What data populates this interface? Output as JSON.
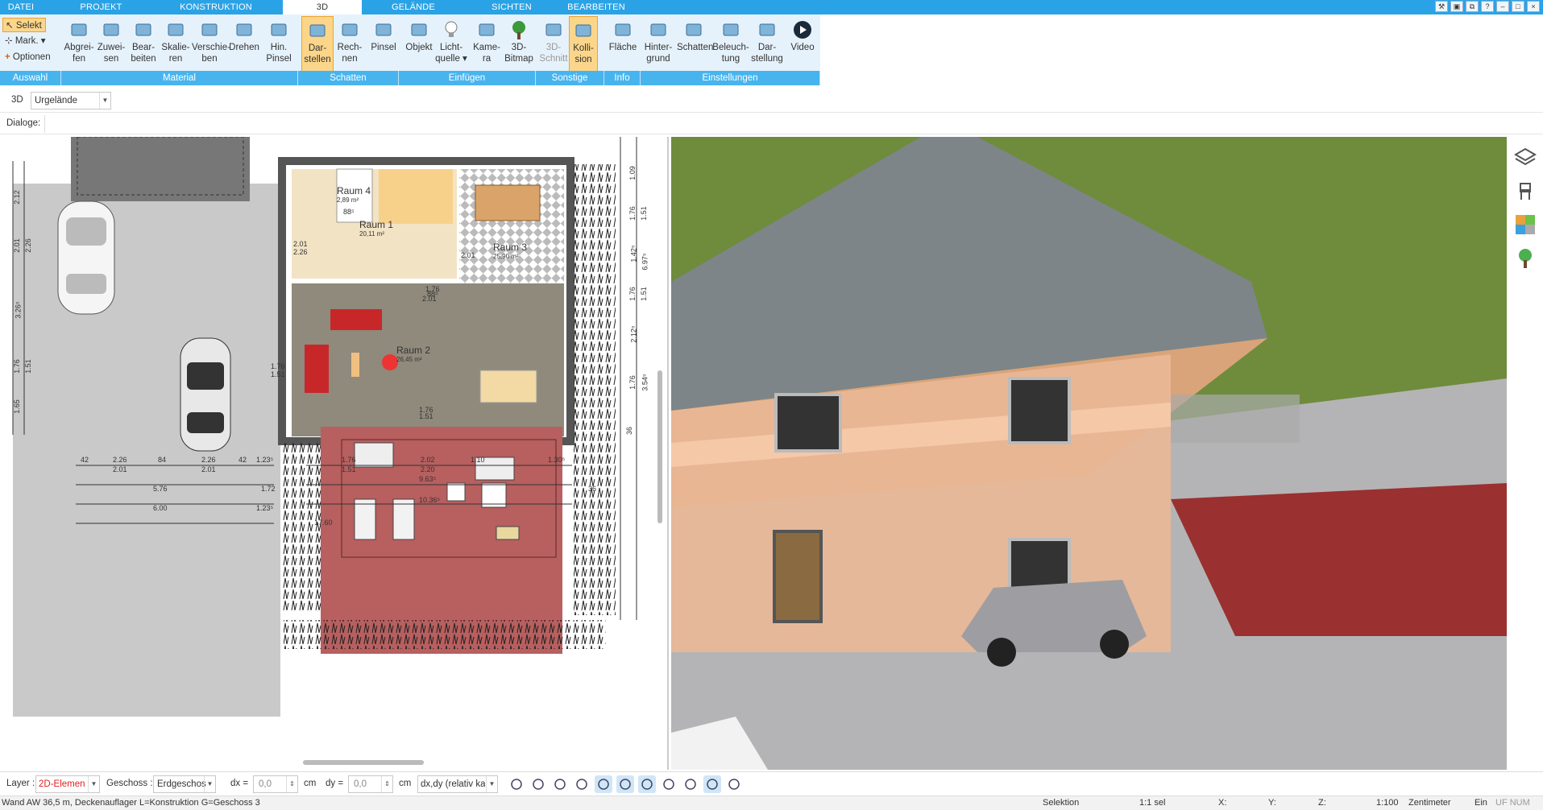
{
  "menu_tabs": [
    "DATEI",
    "PROJEKT",
    "KONSTRUKTION",
    "3D",
    "GELÄNDE",
    "SICHTEN",
    "BEARBEITEN"
  ],
  "active_tab": "3D",
  "ribbon": {
    "selection": {
      "select_label": "Selekt",
      "mark_label": "Mark.",
      "options_label": "Optionen"
    },
    "buttons": [
      {
        "label1": "Abgrei-",
        "label2": "fen",
        "icon": "eyedropper-icon"
      },
      {
        "label1": "Zuwei-",
        "label2": "sen",
        "icon": "assign-material-icon"
      },
      {
        "label1": "Bear-",
        "label2": "beiten",
        "icon": "edit-material-icon"
      },
      {
        "label1": "Skalie-",
        "label2": "ren",
        "icon": "scale-icon"
      },
      {
        "label1": "Verschie-",
        "label2": "ben",
        "icon": "move-icon"
      },
      {
        "label1": "Drehen",
        "label2": "",
        "icon": "rotate-icon"
      },
      {
        "label1": "Hin.",
        "label2": "Pinsel",
        "icon": "brush-icon"
      },
      {
        "label1": "Dar-",
        "label2": "stellen",
        "icon": "shadow-display-icon"
      },
      {
        "label1": "Rech-",
        "label2": "nen",
        "icon": "calculate-icon"
      },
      {
        "label1": "Pinsel",
        "label2": "",
        "icon": "shadow-brush-icon"
      },
      {
        "label1": "Objekt",
        "label2": "",
        "icon": "object-icon"
      },
      {
        "label1": "Licht-",
        "label2": "quelle ▾",
        "icon": "lightbulb-icon"
      },
      {
        "label1": "Kame-",
        "label2": "ra",
        "icon": "camera-icon"
      },
      {
        "label1": "3D-",
        "label2": "Bitmap",
        "icon": "tree-icon"
      },
      {
        "label1": "3D-",
        "label2": "Schnitt",
        "icon": "section-icon"
      },
      {
        "label1": "Kolli-",
        "label2": "sion",
        "icon": "collision-icon"
      },
      {
        "label1": "Fläche",
        "label2": "",
        "icon": "area-icon"
      },
      {
        "label1": "Hinter-",
        "label2": "grund",
        "icon": "background-icon"
      },
      {
        "label1": "Schatten",
        "label2": "",
        "icon": "house-shadow-icon"
      },
      {
        "label1": "Beleuch-",
        "label2": "tung",
        "icon": "lighting-icon"
      },
      {
        "label1": "Dar-",
        "label2": "stellung",
        "icon": "monitor-icon"
      },
      {
        "label1": "Video",
        "label2": "",
        "icon": "play-icon"
      }
    ],
    "groups": [
      "Auswahl",
      "Material",
      "Schatten",
      "Einfügen",
      "Sonstige",
      "Info",
      "Einstellungen"
    ]
  },
  "toolbar2": {
    "mode": "3D",
    "layer_select": "Urgelände"
  },
  "toolbar3": {
    "dialog_label": "Dialoge:"
  },
  "plan": {
    "rooms": [
      {
        "name": "Raum 4",
        "area": "2,89 m²"
      },
      {
        "name": "Raum 1",
        "area": "20,11 m²"
      },
      {
        "name": "Raum 3",
        "area": "25,90 m²"
      },
      {
        "name": "Raum 2",
        "area": "26,45 m²"
      }
    ],
    "dims_bottom": [
      "42",
      "2.26",
      "84",
      "2.26",
      "42",
      "1.23⁵",
      "2.01",
      "2.01",
      "5.76",
      "1.72",
      "6.00",
      "1.23⁵",
      "1.76",
      "2.02",
      "1.51",
      "2.20",
      "1.10",
      "1.30⁵",
      "9.63⁵",
      "10.36⁵",
      "17.60",
      "36"
    ],
    "dims_right": [
      "1.09",
      "1.76",
      "1.51",
      "1.42⁵",
      "6.97⁵",
      "1.76",
      "1.51",
      "2.12⁵",
      "1.76",
      "3.54⁵",
      "36"
    ],
    "dims_left": [
      "2.12",
      "2.01",
      "2.26",
      "1.76",
      "1.51",
      "1.65",
      "3.26⁵"
    ],
    "small_labels": [
      "2.01",
      "2.26",
      "1.76",
      "1.51",
      "1.76",
      "88⁵",
      "2.01",
      "88⁵",
      "2.01",
      "1.76",
      "1.51"
    ]
  },
  "statusbar": {
    "layer_label": "Layer :",
    "layer_value": "2D-Elemen",
    "floor_label": "Geschoss :",
    "floor_value": "Erdgeschos",
    "dx_label": "dx =",
    "dx_value": "0,0",
    "dx_unit": "cm",
    "dy_label": "dy =",
    "dy_value": "0,0",
    "dy_unit": "cm",
    "mode_value": "dx,dy (relativ ka"
  },
  "infobar": {
    "message": "Wand AW 36,5 m, Deckenauflager L=Konstruktion G=Geschoss 3",
    "selection": "Selektion",
    "count": "1:1 sel",
    "x": "X:",
    "y": "Y:",
    "z": "Z:",
    "scale": "1:100",
    "unit": "Zentimeter",
    "ein": "Ein",
    "flags": "UF NUM RF"
  },
  "colors": {
    "tab_bar": "#2aa3e6",
    "group_bar": "#48b4ee",
    "ribbon_bg": "#e6f2fb",
    "active": "#fbd68a",
    "red_layer": "#e02020"
  }
}
